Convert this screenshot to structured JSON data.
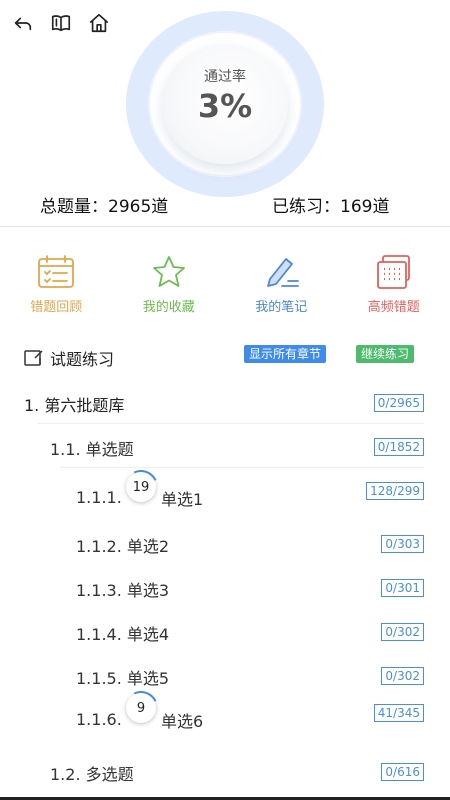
{
  "nav": {
    "icons": [
      "back-arrow-icon",
      "book-icon",
      "home-icon"
    ]
  },
  "progress": {
    "label": "通过率",
    "value": "3%",
    "percent": 3
  },
  "stats": {
    "total": "总题量：2965道",
    "practiced": "已练习：169道"
  },
  "actions": [
    {
      "label": "错题回顾",
      "icon": "calendar-checklist-icon",
      "color": "#e0a64d"
    },
    {
      "label": "我的收藏",
      "icon": "star-icon",
      "color": "#6bbd4f"
    },
    {
      "label": "我的笔记",
      "icon": "pen-icon",
      "color": "#4c88d8"
    },
    {
      "label": "高频错题",
      "icon": "grid-cards-icon",
      "color": "#e0605c"
    }
  ],
  "section": {
    "title": "试题练习",
    "show_all": "显示所有章节",
    "continue": "继续练习"
  },
  "tree": [
    {
      "label": "1. 第六批题库",
      "count": "0/2965"
    },
    {
      "label": "1.1. 单选题",
      "count": "0/1852"
    },
    {
      "prefix": "1.1.1.",
      "badge": "19",
      "label": "单选1",
      "count": "128/299"
    },
    {
      "label": "1.1.2. 单选2",
      "count": "0/303"
    },
    {
      "label": "1.1.3. 单选3",
      "count": "0/301"
    },
    {
      "label": "1.1.4. 单选4",
      "count": "0/302"
    },
    {
      "label": "1.1.5. 单选5",
      "count": "0/302"
    },
    {
      "prefix": "1.1.6.",
      "badge": "9",
      "label": "单选6",
      "count": "41/345"
    },
    {
      "label": "1.2. 多选题",
      "count": "0/616"
    }
  ]
}
